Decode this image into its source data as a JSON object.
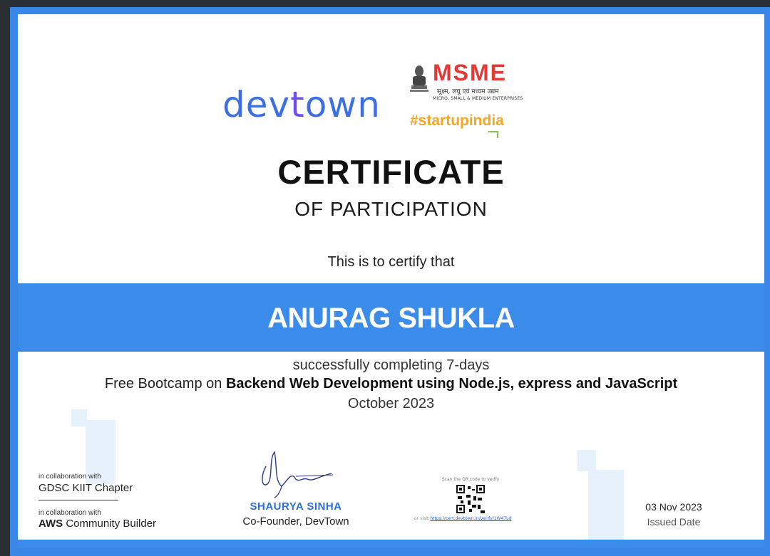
{
  "logos": {
    "devtown_prefix": "dev",
    "devtown_accent": "t",
    "devtown_suffix": "own",
    "msme_text": "MSME",
    "msme_hindi": "सूक्ष्म, लघु एवं मध्यम उद्यम",
    "msme_english": "MICRO, SMALL & MEDIUM ENTERPRISES",
    "startup_text": "#startupindia"
  },
  "certificate": {
    "title": "CERTIFICATE",
    "subtitle": "OF PARTICIPATION",
    "certify_text": "This is to certify that",
    "recipient_name": "ANURAG SHUKLA",
    "line1": "successfully completing 7-days",
    "line2_prefix": "Free Bootcamp on ",
    "line2_bold": "Backend Web Development using Node.js, express and JavaScript",
    "line3": "October 2023"
  },
  "footer": {
    "collab1_small": "in collaboration with",
    "collab1_name": "GDSC KIIT Chapter",
    "collab2_small": "in collaboration with",
    "collab2_bold": "AWS",
    "collab2_rest": " Community Builder",
    "signatory_name": "SHAURYA SINHA",
    "signatory_role": "Co-Founder, DevTown",
    "qr_scan_text": "Scan the QR code to verify",
    "qr_visit_prefix": "or visit ",
    "qr_link": "https://cert.devtown.in/verify/1W47Ld",
    "issued_date": "03 Nov 2023",
    "issued_label": "Issued Date"
  },
  "colors": {
    "brand_blue": "#3b8bea",
    "devtown_blue": "#3d6fe0",
    "msme_red": "#e53935",
    "startup_orange": "#f5a623"
  },
  "icons": [
    "emblem-icon",
    "signature-icon",
    "qr-code-icon",
    "startup-mark-icon"
  ]
}
